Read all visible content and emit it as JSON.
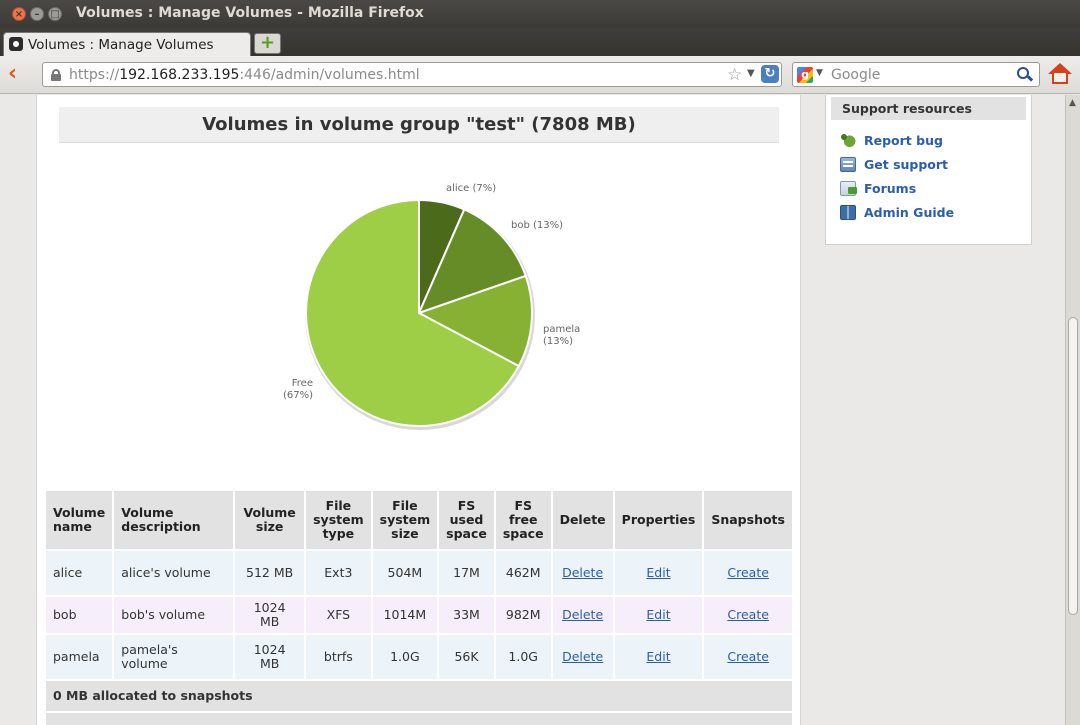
{
  "window": {
    "title": "Volumes : Manage Volumes - Mozilla Firefox",
    "close_glyph": "×",
    "min_glyph": "–",
    "max_glyph": "□"
  },
  "tabs": [
    {
      "label": "Volumes : Manage Volumes",
      "active": true
    }
  ],
  "new_tab_glyph": "+",
  "navbar": {
    "url_scheme": "https://",
    "url_host": "192.168.233.195",
    "url_rest": ":446/admin/volumes.html",
    "search_placeholder": "Google",
    "google_glyph": "g"
  },
  "main": {
    "heading": "Volumes in volume group \"test\" (7808 MB)"
  },
  "chart_data": {
    "type": "pie",
    "slices": [
      {
        "label": "alice (7%)",
        "value": 512,
        "color": "#4b6b1a"
      },
      {
        "label": "bob (13%)",
        "value": 1024,
        "color": "#658c26"
      },
      {
        "label_lines": [
          "pamela",
          "(13%)"
        ],
        "value": 1024,
        "color": "#86b132"
      },
      {
        "label_lines": [
          "Free",
          "(67%)"
        ],
        "value": 5248,
        "color": "#9ecd46"
      }
    ],
    "start": "top, clockwise"
  },
  "table": {
    "headers": [
      "Volume name",
      "Volume description",
      "Volume size",
      "File system type",
      "File system size",
      "FS used space",
      "FS free space",
      "Delete",
      "Properties",
      "Snapshots"
    ],
    "header_lines": [
      [
        "Volume",
        "name"
      ],
      [
        "Volume",
        "description"
      ],
      [
        "Volume",
        "size"
      ],
      [
        "File",
        "system",
        "type"
      ],
      [
        "File",
        "system",
        "size"
      ],
      [
        "FS",
        "used",
        "space"
      ],
      [
        "FS",
        "free",
        "space"
      ],
      [
        "Delete"
      ],
      [
        "Properties"
      ],
      [
        "Snapshots"
      ]
    ],
    "rows": [
      {
        "name": "alice",
        "description": "alice's volume",
        "size": "512 MB",
        "fs_type": "Ext3",
        "fs_size": "504M",
        "used": "17M",
        "free": "462M",
        "delete": "Delete",
        "properties": "Edit",
        "snapshots": "Create"
      },
      {
        "name": "bob",
        "description": "bob's volume",
        "size": "1024 MB",
        "fs_type": "XFS",
        "fs_size": "1014M",
        "used": "33M",
        "free": "982M",
        "delete": "Delete",
        "properties": "Edit",
        "snapshots": "Create"
      },
      {
        "name": "pamela",
        "description": "pamela's volume",
        "size": "1024 MB",
        "fs_type": "btrfs",
        "fs_size": "1.0G",
        "used": "56K",
        "free": "1.0G",
        "delete": "Delete",
        "properties": "Edit",
        "snapshots": "Create"
      }
    ],
    "summary": "0 MB allocated to snapshots"
  },
  "sidebar": {
    "title": "Support resources",
    "items": [
      {
        "label": "Report bug",
        "icon": "bug-icon"
      },
      {
        "label": "Get support",
        "icon": "support-icon"
      },
      {
        "label": "Forums",
        "icon": "forums-icon"
      },
      {
        "label": "Admin Guide",
        "icon": "guide-icon"
      }
    ]
  }
}
